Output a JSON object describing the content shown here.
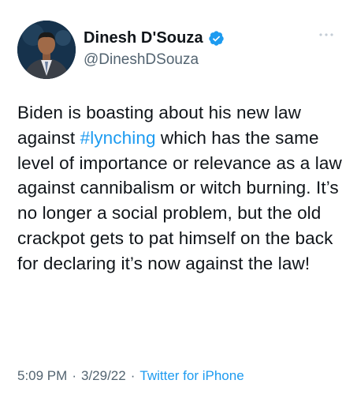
{
  "author": {
    "name": "Dinesh D'Souza",
    "handle": "@DineshDSouza",
    "verified": true
  },
  "tweet": {
    "text_before": "Biden is boasting about his new law against ",
    "hashtag": "#lynching",
    "text_after": " which has the same level of importance or relevance as a law against cannibalism or witch burning. It’s no longer a social problem, but the old crackpot gets to pat himself on the back for declaring it’s now against the law!",
    "time": "5:09 PM",
    "date": "3/29/22",
    "separator": "·",
    "source": "Twitter for iPhone"
  },
  "icons": {
    "verified": "verified-badge-icon",
    "more": "more-options-icon"
  },
  "colors": {
    "link": "#1d9bf0",
    "text": "#0f1419",
    "secondary": "#536471"
  }
}
